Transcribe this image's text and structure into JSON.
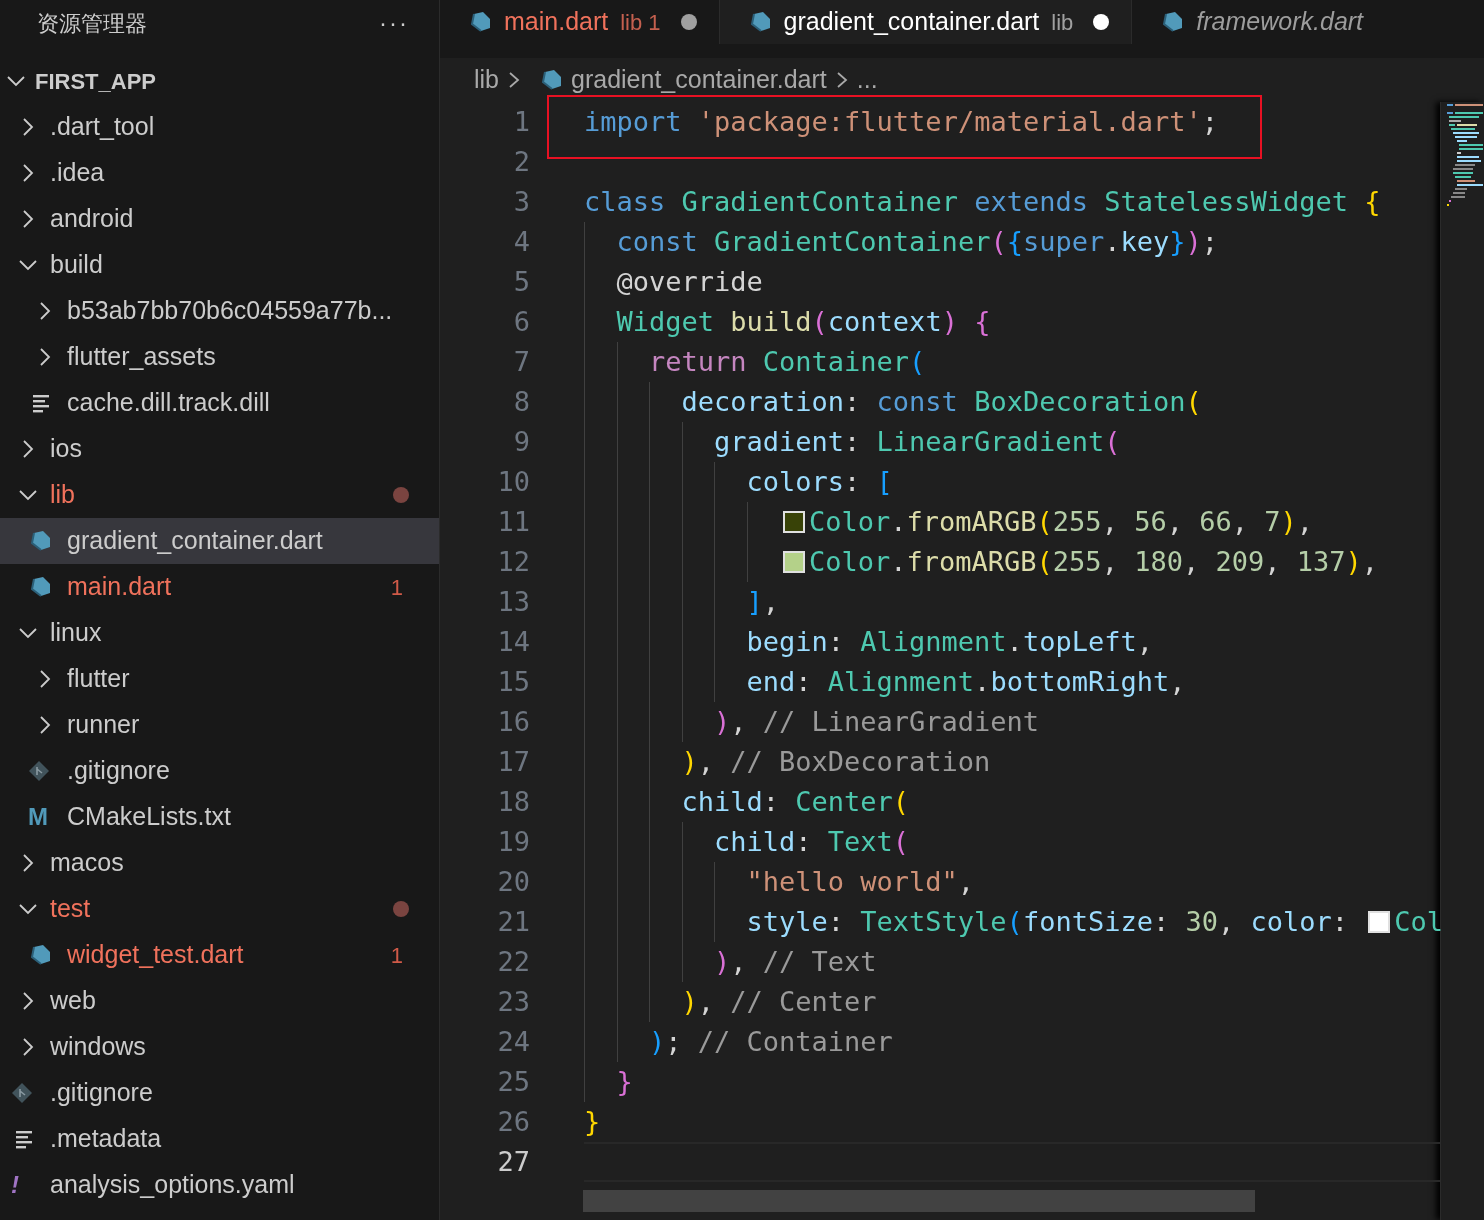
{
  "explorer": {
    "title": "资源管理器",
    "more": "···",
    "root": {
      "name": "FIRST_APP",
      "expanded": true
    },
    "tree": [
      {
        "name": ".dart_tool",
        "kind": "folder",
        "expanded": false,
        "selected": false,
        "problems": false
      },
      {
        "name": ".idea",
        "kind": "folder",
        "expanded": false,
        "selected": false,
        "problems": false
      },
      {
        "name": "android",
        "kind": "folder",
        "expanded": false,
        "selected": false,
        "problems": false
      },
      {
        "name": "build",
        "kind": "folder",
        "expanded": true,
        "selected": false,
        "problems": false,
        "children": [
          {
            "name": "b53ab7bb70b6c04559a77b...",
            "kind": "folder",
            "expanded": false,
            "selected": false,
            "problems": false
          },
          {
            "name": "flutter_assets",
            "kind": "folder",
            "expanded": false,
            "selected": false,
            "problems": false
          },
          {
            "name": "cache.dill.track.dill",
            "kind": "lines",
            "selected": false,
            "problems": false
          }
        ]
      },
      {
        "name": "ios",
        "kind": "folder",
        "expanded": false,
        "selected": false,
        "problems": false
      },
      {
        "name": "lib",
        "kind": "folder",
        "expanded": true,
        "selected": false,
        "problems": true,
        "children": [
          {
            "name": "gradient_container.dart",
            "kind": "dart",
            "selected": true,
            "problems": false
          },
          {
            "name": "main.dart",
            "kind": "dart",
            "selected": false,
            "problems": true,
            "badge": "1"
          }
        ]
      },
      {
        "name": "linux",
        "kind": "folder",
        "expanded": true,
        "selected": false,
        "problems": false,
        "children": [
          {
            "name": "flutter",
            "kind": "folder",
            "expanded": false,
            "selected": false,
            "problems": false
          },
          {
            "name": "runner",
            "kind": "folder",
            "expanded": false,
            "selected": false,
            "problems": false
          },
          {
            "name": ".gitignore",
            "kind": "git",
            "selected": false,
            "problems": false
          },
          {
            "name": "CMakeLists.txt",
            "kind": "glyph",
            "glyph": "M",
            "selected": false,
            "problems": false
          }
        ]
      },
      {
        "name": "macos",
        "kind": "folder",
        "expanded": false,
        "selected": false,
        "problems": false
      },
      {
        "name": "test",
        "kind": "folder",
        "expanded": true,
        "selected": false,
        "problems": true,
        "children": [
          {
            "name": "widget_test.dart",
            "kind": "dart",
            "selected": false,
            "problems": true,
            "badge": "1"
          }
        ]
      },
      {
        "name": "web",
        "kind": "folder",
        "expanded": false,
        "selected": false,
        "problems": false
      },
      {
        "name": "windows",
        "kind": "folder",
        "expanded": false,
        "selected": false,
        "problems": false
      },
      {
        "name": ".gitignore",
        "kind": "git",
        "selected": false,
        "problems": false
      },
      {
        "name": ".metadata",
        "kind": "lines",
        "selected": false,
        "problems": false
      },
      {
        "name": "analysis_options.yaml",
        "kind": "glyph",
        "glyph": "!",
        "selected": false,
        "problems": false
      }
    ]
  },
  "tabs": [
    {
      "label": "main.dart",
      "description": "lib 1",
      "selected": false,
      "problems": true,
      "modified": true,
      "preview": false
    },
    {
      "label": "gradient_container.dart",
      "description": "lib",
      "selected": true,
      "problems": false,
      "modified": true,
      "preview": false
    },
    {
      "label": "framework.dart",
      "selected": false,
      "problems": false,
      "modified": false,
      "preview": true
    }
  ],
  "breadcrumb": [
    "lib",
    "gradient_container.dart",
    "..."
  ],
  "code": [
    {
      "number": "1",
      "current": false,
      "annotated": true,
      "tokens": [
        {
          "text": "import ",
          "kind": "kw"
        },
        {
          "text": "'package:flutter/material.dart'",
          "kind": "str"
        },
        {
          "text": ";",
          "kind": "p"
        }
      ]
    },
    {
      "number": "2",
      "current": false
    },
    {
      "number": "3",
      "current": false,
      "tokens": [
        {
          "text": "class ",
          "kind": "kw"
        },
        {
          "text": "GradientContainer ",
          "kind": "type"
        },
        {
          "text": "extends ",
          "kind": "kw"
        },
        {
          "text": "StatelessWidget ",
          "kind": "type"
        },
        {
          "text": "{",
          "kind": "b1"
        }
      ],
      "children": [
        {
          "number": "4",
          "current": false,
          "tokens": [
            {
              "text": "const ",
              "kind": "kw"
            },
            {
              "text": "GradientContainer",
              "kind": "type"
            },
            {
              "text": "(",
              "kind": "b2"
            },
            {
              "text": "{",
              "kind": "b3"
            },
            {
              "text": "super",
              "kind": "kw"
            },
            {
              "text": ".",
              "kind": "p"
            },
            {
              "text": "key",
              "kind": "var"
            },
            {
              "text": "}",
              "kind": "b3"
            },
            {
              "text": ")",
              "kind": "b2"
            },
            {
              "text": ";",
              "kind": "p"
            }
          ]
        },
        {
          "number": "5",
          "current": false,
          "tokens": [
            {
              "text": "@override",
              "kind": "p"
            }
          ]
        },
        {
          "number": "6",
          "current": false,
          "tokens": [
            {
              "text": "Widget ",
              "kind": "type"
            },
            {
              "text": "build",
              "kind": "func"
            },
            {
              "text": "(",
              "kind": "b2"
            },
            {
              "text": "context",
              "kind": "var"
            },
            {
              "text": ") ",
              "kind": "b2"
            },
            {
              "text": "{",
              "kind": "b2"
            }
          ],
          "children": [
            {
              "number": "7",
              "current": false,
              "tokens": [
                {
                  "text": "return ",
                  "kind": "ctl"
                },
                {
                  "text": "Container",
                  "kind": "type"
                },
                {
                  "text": "(",
                  "kind": "b3"
                }
              ],
              "children": [
                {
                  "number": "8",
                  "current": false,
                  "tokens": [
                    {
                      "text": "decoration",
                      "kind": "var"
                    },
                    {
                      "text": ": ",
                      "kind": "p"
                    },
                    {
                      "text": "const ",
                      "kind": "kw"
                    },
                    {
                      "text": "BoxDecoration",
                      "kind": "type"
                    },
                    {
                      "text": "(",
                      "kind": "b1"
                    }
                  ],
                  "children": [
                    {
                      "number": "9",
                      "current": false,
                      "tokens": [
                        {
                          "text": "gradient",
                          "kind": "var"
                        },
                        {
                          "text": ": ",
                          "kind": "p"
                        },
                        {
                          "text": "LinearGradient",
                          "kind": "type"
                        },
                        {
                          "text": "(",
                          "kind": "b2"
                        }
                      ],
                      "children": [
                        {
                          "number": "10",
                          "current": false,
                          "tokens": [
                            {
                              "text": "colors",
                              "kind": "var"
                            },
                            {
                              "text": ": ",
                              "kind": "p"
                            },
                            {
                              "text": "[",
                              "kind": "b3"
                            }
                          ],
                          "children": [
                            {
                              "number": "11",
                              "current": false,
                              "tokens": [
                                {
                                  "kind": "swatch",
                                  "color": "#384207"
                                },
                                {
                                  "text": "Color",
                                  "kind": "type"
                                },
                                {
                                  "text": ".",
                                  "kind": "p"
                                },
                                {
                                  "text": "fromARGB",
                                  "kind": "func"
                                },
                                {
                                  "text": "(",
                                  "kind": "b1"
                                },
                                {
                                  "text": "255",
                                  "kind": "num"
                                },
                                {
                                  "text": ", ",
                                  "kind": "p"
                                },
                                {
                                  "text": "56",
                                  "kind": "num"
                                },
                                {
                                  "text": ", ",
                                  "kind": "p"
                                },
                                {
                                  "text": "66",
                                  "kind": "num"
                                },
                                {
                                  "text": ", ",
                                  "kind": "p"
                                },
                                {
                                  "text": "7",
                                  "kind": "num"
                                },
                                {
                                  "text": ")",
                                  "kind": "b1"
                                },
                                {
                                  "text": ",",
                                  "kind": "p"
                                }
                              ]
                            },
                            {
                              "number": "12",
                              "current": false,
                              "tokens": [
                                {
                                  "kind": "swatch",
                                  "color": "#b4d189"
                                },
                                {
                                  "text": "Color",
                                  "kind": "type"
                                },
                                {
                                  "text": ".",
                                  "kind": "p"
                                },
                                {
                                  "text": "fromARGB",
                                  "kind": "func"
                                },
                                {
                                  "text": "(",
                                  "kind": "b1"
                                },
                                {
                                  "text": "255",
                                  "kind": "num"
                                },
                                {
                                  "text": ", ",
                                  "kind": "p"
                                },
                                {
                                  "text": "180",
                                  "kind": "num"
                                },
                                {
                                  "text": ", ",
                                  "kind": "p"
                                },
                                {
                                  "text": "209",
                                  "kind": "num"
                                },
                                {
                                  "text": ", ",
                                  "kind": "p"
                                },
                                {
                                  "text": "137",
                                  "kind": "num"
                                },
                                {
                                  "text": ")",
                                  "kind": "b1"
                                },
                                {
                                  "text": ",",
                                  "kind": "p"
                                }
                              ]
                            }
                          ]
                        },
                        {
                          "number": "13",
                          "current": false,
                          "tokens": [
                            {
                              "text": "]",
                              "kind": "b3"
                            },
                            {
                              "text": ",",
                              "kind": "p"
                            }
                          ]
                        },
                        {
                          "number": "14",
                          "current": false,
                          "tokens": [
                            {
                              "text": "begin",
                              "kind": "var"
                            },
                            {
                              "text": ": ",
                              "kind": "p"
                            },
                            {
                              "text": "Alignment",
                              "kind": "type"
                            },
                            {
                              "text": ".",
                              "kind": "p"
                            },
                            {
                              "text": "topLeft",
                              "kind": "var"
                            },
                            {
                              "text": ",",
                              "kind": "p"
                            }
                          ]
                        },
                        {
                          "number": "15",
                          "current": false,
                          "tokens": [
                            {
                              "text": "end",
                              "kind": "var"
                            },
                            {
                              "text": ": ",
                              "kind": "p"
                            },
                            {
                              "text": "Alignment",
                              "kind": "type"
                            },
                            {
                              "text": ".",
                              "kind": "p"
                            },
                            {
                              "text": "bottomRight",
                              "kind": "var"
                            },
                            {
                              "text": ",",
                              "kind": "p"
                            }
                          ]
                        }
                      ]
                    },
                    {
                      "number": "16",
                      "current": false,
                      "tokens": [
                        {
                          "text": ")",
                          "kind": "b2"
                        },
                        {
                          "text": ", ",
                          "kind": "p"
                        },
                        {
                          "text": "// LinearGradient",
                          "kind": "comment"
                        }
                      ]
                    }
                  ]
                },
                {
                  "number": "17",
                  "current": false,
                  "tokens": [
                    {
                      "text": ")",
                      "kind": "b1"
                    },
                    {
                      "text": ", ",
                      "kind": "p"
                    },
                    {
                      "text": "// BoxDecoration",
                      "kind": "comment"
                    }
                  ]
                },
                {
                  "number": "18",
                  "current": false,
                  "tokens": [
                    {
                      "text": "child",
                      "kind": "var"
                    },
                    {
                      "text": ": ",
                      "kind": "p"
                    },
                    {
                      "text": "Center",
                      "kind": "type"
                    },
                    {
                      "text": "(",
                      "kind": "b1"
                    }
                  ],
                  "children": [
                    {
                      "number": "19",
                      "current": false,
                      "tokens": [
                        {
                          "text": "child",
                          "kind": "var"
                        },
                        {
                          "text": ": ",
                          "kind": "p"
                        },
                        {
                          "text": "Text",
                          "kind": "type"
                        },
                        {
                          "text": "(",
                          "kind": "b2"
                        }
                      ],
                      "children": [
                        {
                          "number": "20",
                          "current": false,
                          "tokens": [
                            {
                              "text": "\"hello world\"",
                              "kind": "str"
                            },
                            {
                              "text": ",",
                              "kind": "p"
                            }
                          ]
                        },
                        {
                          "number": "21",
                          "current": false,
                          "tokens": [
                            {
                              "text": "style",
                              "kind": "var"
                            },
                            {
                              "text": ": ",
                              "kind": "p"
                            },
                            {
                              "text": "TextStyle",
                              "kind": "type"
                            },
                            {
                              "text": "(",
                              "kind": "b3"
                            },
                            {
                              "text": "fontSize",
                              "kind": "var"
                            },
                            {
                              "text": ": ",
                              "kind": "p"
                            },
                            {
                              "text": "30",
                              "kind": "num"
                            },
                            {
                              "text": ", ",
                              "kind": "p"
                            },
                            {
                              "text": "color",
                              "kind": "var"
                            },
                            {
                              "text": ": ",
                              "kind": "p"
                            },
                            {
                              "kind": "swatch",
                              "color": "#ffffff"
                            },
                            {
                              "text": "Col",
                              "kind": "type"
                            }
                          ]
                        }
                      ]
                    },
                    {
                      "number": "22",
                      "current": false,
                      "tokens": [
                        {
                          "text": ")",
                          "kind": "b2"
                        },
                        {
                          "text": ", ",
                          "kind": "p"
                        },
                        {
                          "text": "// Text",
                          "kind": "comment"
                        }
                      ]
                    }
                  ]
                },
                {
                  "number": "23",
                  "current": false,
                  "tokens": [
                    {
                      "text": ")",
                      "kind": "b1"
                    },
                    {
                      "text": ", ",
                      "kind": "p"
                    },
                    {
                      "text": "// Center",
                      "kind": "comment"
                    }
                  ]
                }
              ]
            },
            {
              "number": "24",
              "current": false,
              "tokens": [
                {
                  "text": ")",
                  "kind": "b3"
                },
                {
                  "text": "; ",
                  "kind": "p"
                },
                {
                  "text": "// Container",
                  "kind": "comment"
                }
              ]
            }
          ]
        },
        {
          "number": "25",
          "current": false,
          "tokens": [
            {
              "text": "}",
              "kind": "b2"
            }
          ]
        }
      ]
    },
    {
      "number": "26",
      "current": false,
      "tokens": [
        {
          "text": "}",
          "kind": "b1"
        }
      ]
    },
    {
      "number": "27",
      "current": true
    }
  ]
}
